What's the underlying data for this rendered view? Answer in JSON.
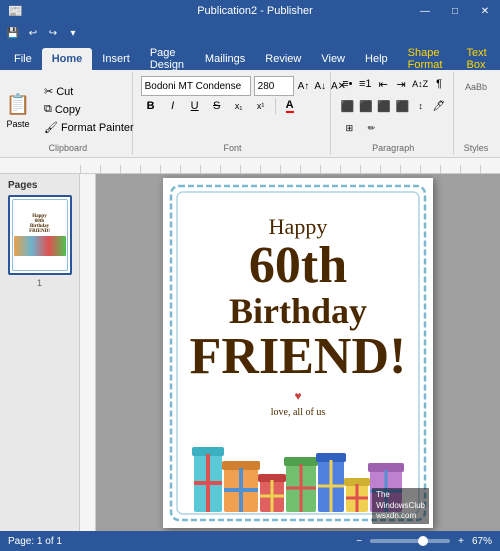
{
  "titlebar": {
    "title": "Publication2 - Publisher",
    "minimize": "—",
    "maximize": "□",
    "close": "✕"
  },
  "quickaccess": {
    "save": "💾",
    "undo": "↩",
    "redo": "↪",
    "more": "▾"
  },
  "tabs": [
    {
      "id": "file",
      "label": "File",
      "active": false
    },
    {
      "id": "home",
      "label": "Home",
      "active": true
    },
    {
      "id": "insert",
      "label": "Insert",
      "active": false
    },
    {
      "id": "pagedesign",
      "label": "Page Design",
      "active": false
    },
    {
      "id": "mailings",
      "label": "Mailings",
      "active": false
    },
    {
      "id": "review",
      "label": "Review",
      "active": false
    },
    {
      "id": "view",
      "label": "View",
      "active": false
    },
    {
      "id": "help",
      "label": "Help",
      "active": false
    },
    {
      "id": "shapeformat",
      "label": "Shape Format",
      "active": false,
      "contextual": true
    },
    {
      "id": "textbox",
      "label": "Text Box",
      "active": false,
      "contextual": true
    }
  ],
  "ribbon": {
    "clipboard": {
      "label": "Clipboard",
      "paste_label": "Paste",
      "cut_label": "Cut",
      "copy_label": "Copy",
      "format_painter_label": "Format Painter"
    },
    "font": {
      "label": "Font",
      "font_name": "Bodoni MT Condense",
      "font_size": "280",
      "bold": "B",
      "italic": "I",
      "underline": "U",
      "strikethrough": "S",
      "subscript": "x₁",
      "superscript": "x¹",
      "font_color": "A",
      "expand": "⌄"
    },
    "paragraph": {
      "label": "Paragraph",
      "expand": "⌄"
    },
    "styles": {
      "label": "Styles"
    }
  },
  "pages": {
    "label": "Pages",
    "page_number": "1"
  },
  "card": {
    "happy": "Happy",
    "sixtieth": "60th",
    "birthday": "Birthday",
    "friend": "FRIEND!",
    "love": "love, all of us"
  },
  "statusbar": {
    "page_info": "Page: 1 of 1",
    "zoom_level": "67%",
    "zoom_minus": "−",
    "zoom_plus": "+"
  },
  "watermark": {
    "line1": "The",
    "line2": "WindowsClub",
    "line3": "wsxdn.com"
  }
}
